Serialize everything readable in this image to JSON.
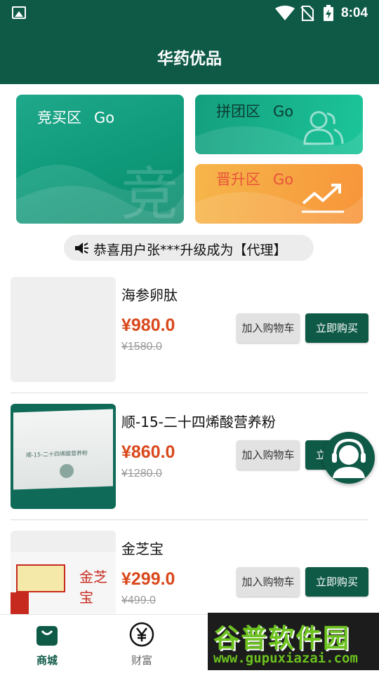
{
  "status_bar": {
    "time": "8:04"
  },
  "app_bar": {
    "title": "华药优品"
  },
  "entry_cards": {
    "auction": {
      "label": "竞买区",
      "go": "Go",
      "bg_char": "竞"
    },
    "group": {
      "label": "拼团区",
      "go": "Go"
    },
    "upgrade": {
      "label": "晋升区",
      "go": "Go"
    }
  },
  "notice": {
    "text": "恭喜用户张***升级成为【代理】"
  },
  "products": [
    {
      "name": "海参卵肽",
      "price": "¥980.0",
      "original_price": "¥1580.0",
      "cart_label": "加入购物车",
      "buy_label": "立即购买"
    },
    {
      "name": "顺-15-二十四烯酸营养粉",
      "price": "¥860.0",
      "original_price": "¥1280.0",
      "cart_label": "加入购物车",
      "buy_label": "立即购买"
    },
    {
      "name": "金芝宝",
      "price": "¥299.0",
      "original_price": "¥499.0",
      "cart_label": "加入购物车",
      "buy_label": "立即购买"
    }
  ],
  "tab_bar": {
    "tabs": [
      {
        "label": "商城",
        "icon": "shopping-bag-icon",
        "active": true
      },
      {
        "label": "财富",
        "icon": "yen-circle-icon",
        "active": false
      }
    ]
  },
  "product_image_text": {
    "p2_pack": "顺-15-二十四烯酸营养粉",
    "p3_brand": "金芝宝"
  },
  "watermark": {
    "brand": "谷普软件园",
    "url": "www.gupuxiazai.com"
  },
  "colors": {
    "primary": "#0f5a47",
    "price": "#d9481c",
    "auction": "#0e9a7a",
    "group": "#1cc59a",
    "upgrade": "#f7953a"
  }
}
